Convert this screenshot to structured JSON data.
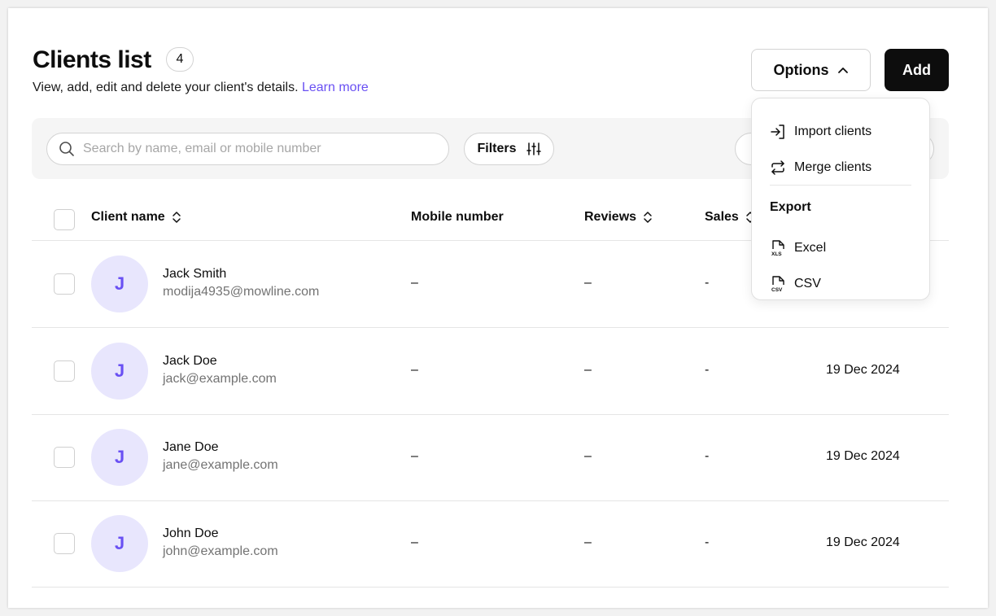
{
  "header": {
    "title": "Clients list",
    "count": "4",
    "subtitle": "View, add, edit and delete your client's details.",
    "learn_more": "Learn more"
  },
  "actions": {
    "options_label": "Options",
    "add_label": "Add"
  },
  "toolbar": {
    "search_placeholder": "Search by name, email or mobile number",
    "filters_label": "Filters"
  },
  "table": {
    "columns": {
      "client_name": "Client name",
      "mobile_number": "Mobile number",
      "reviews": "Reviews",
      "sales": "Sales"
    },
    "rows": [
      {
        "initial": "J",
        "name": "Jack Smith",
        "email": "modija4935@mowline.com",
        "mobile": "–",
        "reviews": "–",
        "sales": "-",
        "created": ""
      },
      {
        "initial": "J",
        "name": "Jack Doe",
        "email": "jack@example.com",
        "mobile": "–",
        "reviews": "–",
        "sales": "-",
        "created": "19 Dec 2024"
      },
      {
        "initial": "J",
        "name": "Jane Doe",
        "email": "jane@example.com",
        "mobile": "–",
        "reviews": "–",
        "sales": "-",
        "created": "19 Dec 2024"
      },
      {
        "initial": "J",
        "name": "John Doe",
        "email": "john@example.com",
        "mobile": "–",
        "reviews": "–",
        "sales": "-",
        "created": "19 Dec 2024"
      }
    ]
  },
  "options_menu": {
    "import": "Import clients",
    "merge": "Merge clients",
    "export_heading": "Export",
    "excel": "Excel",
    "csv": "CSV"
  },
  "colors": {
    "accent": "#6950f3",
    "avatar_bg": "#e8e6fd",
    "primary_button": "#0d0d0d"
  },
  "icons": {
    "search": "search-icon",
    "filters": "sliders-icon",
    "sort": "sort-arrows-icon",
    "options_chevron": "chevron-up-icon",
    "import": "import-arrow-icon",
    "merge": "merge-arrows-icon",
    "excel": "xls-file-icon",
    "csv": "csv-file-icon"
  }
}
